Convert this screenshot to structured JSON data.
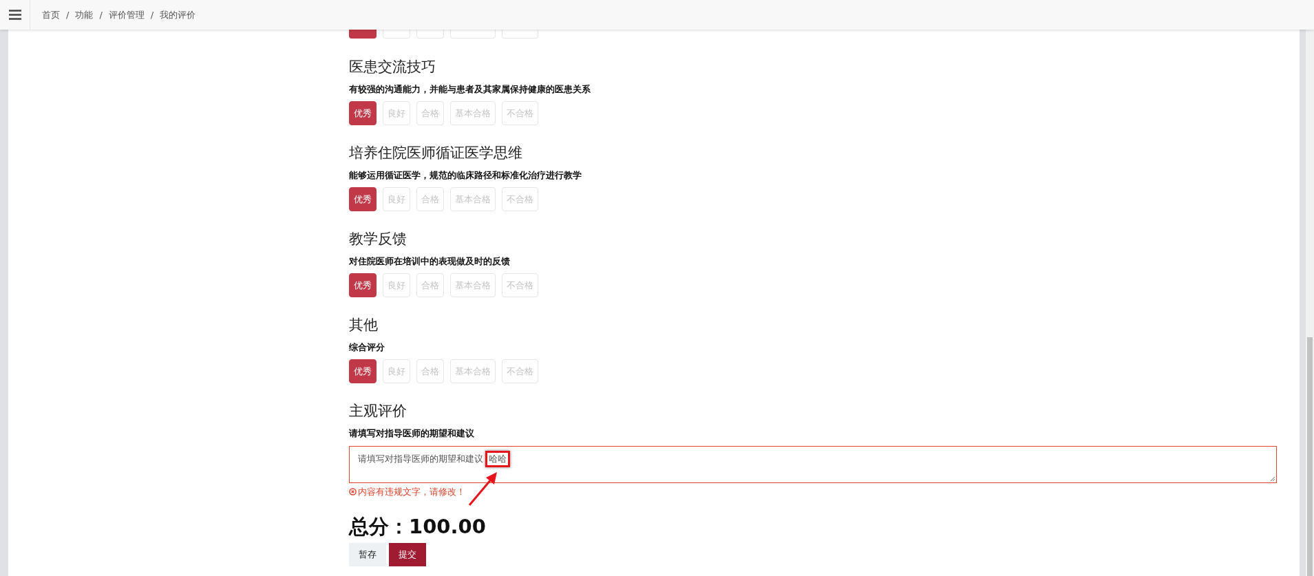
{
  "breadcrumb": [
    "首页",
    "功能",
    "评价管理",
    "我的评价"
  ],
  "breadcrumb_separator": "/",
  "sections": [
    {
      "options": [
        {
          "selected": true
        },
        {
          "selected": false
        },
        {
          "selected": false
        },
        {
          "selected": false
        },
        {
          "selected": false
        }
      ]
    },
    {
      "title": "医患交流技巧",
      "description": "有较强的沟通能力，并能与患者及其家属保持健康的医患关系",
      "options": [
        {
          "label": "优秀",
          "selected": true
        },
        {
          "label": "良好",
          "selected": false
        },
        {
          "label": "合格",
          "selected": false
        },
        {
          "label": "基本合格",
          "selected": false
        },
        {
          "label": "不合格",
          "selected": false
        }
      ]
    },
    {
      "title": "培养住院医师循证医学思维",
      "description": "能够运用循证医学，规范的临床路径和标准化治疗进行教学",
      "options": [
        {
          "label": "优秀",
          "selected": true
        },
        {
          "label": "良好",
          "selected": false
        },
        {
          "label": "合格",
          "selected": false
        },
        {
          "label": "基本合格",
          "selected": false
        },
        {
          "label": "不合格",
          "selected": false
        }
      ]
    },
    {
      "title": "教学反馈",
      "description": "对住院医师在培训中的表现做及时的反馈",
      "options": [
        {
          "label": "优秀",
          "selected": true
        },
        {
          "label": "良好",
          "selected": false
        },
        {
          "label": "合格",
          "selected": false
        },
        {
          "label": "基本合格",
          "selected": false
        },
        {
          "label": "不合格",
          "selected": false
        }
      ]
    },
    {
      "title": "其他",
      "description": "综合评分",
      "options": [
        {
          "label": "优秀",
          "selected": true
        },
        {
          "label": "良好",
          "selected": false
        },
        {
          "label": "合格",
          "selected": false
        },
        {
          "label": "基本合格",
          "selected": false
        },
        {
          "label": "不合格",
          "selected": false
        }
      ]
    }
  ],
  "subjective": {
    "title": "主观评价",
    "description": "请填写对指导医师的期望和建议",
    "value": "请填写对指导医师的期望和建议",
    "highlighted": "哈哈",
    "invalid": true,
    "error": "内容有违规文字，请修改！"
  },
  "total": "总分：100.00",
  "buttons": [
    {
      "label": "暂存",
      "kind": "secondary"
    },
    {
      "label": "提交",
      "kind": "primary"
    }
  ]
}
